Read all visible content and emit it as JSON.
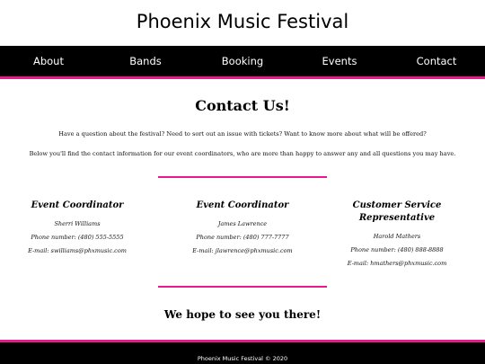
{
  "site": {
    "title": "Phoenix Music Festival"
  },
  "nav": {
    "items": [
      {
        "label": "About"
      },
      {
        "label": "Bands"
      },
      {
        "label": "Booking"
      },
      {
        "label": "Events"
      },
      {
        "label": "Contact"
      }
    ]
  },
  "main": {
    "heading": "Contact Us!",
    "intro": [
      "Have a question about the festival? Need to sort out an issue with tickets? Want to know more about what will be offered?",
      "Below you'll find the contact information for our event coordinators, who are more than happy to answer any and all questions you may have."
    ],
    "coordinators": [
      {
        "title": "Event Coordinator",
        "name": "Sherri Williams",
        "phone": "Phone number: (480) 555-5555",
        "email": "E-mail: swilliams@phxmusic.com"
      },
      {
        "title": "Event Coordinator",
        "name": "James Lawrence",
        "phone": "Phone number: (480) 777-7777",
        "email": "E-mail: jlawrence@phxmusic.com"
      },
      {
        "title": "Customer Service Representative",
        "name": "Harold Mathers",
        "phone": "Phone number: (480) 888-8888",
        "email": "E-mail: hmathers@phxmusic.com"
      }
    ],
    "closing": "We hope to see you there!"
  },
  "footer": {
    "text": "Phoenix Music Festival © 2020"
  },
  "colors": {
    "accent": "#e8198b",
    "nav_background": "#000000"
  }
}
